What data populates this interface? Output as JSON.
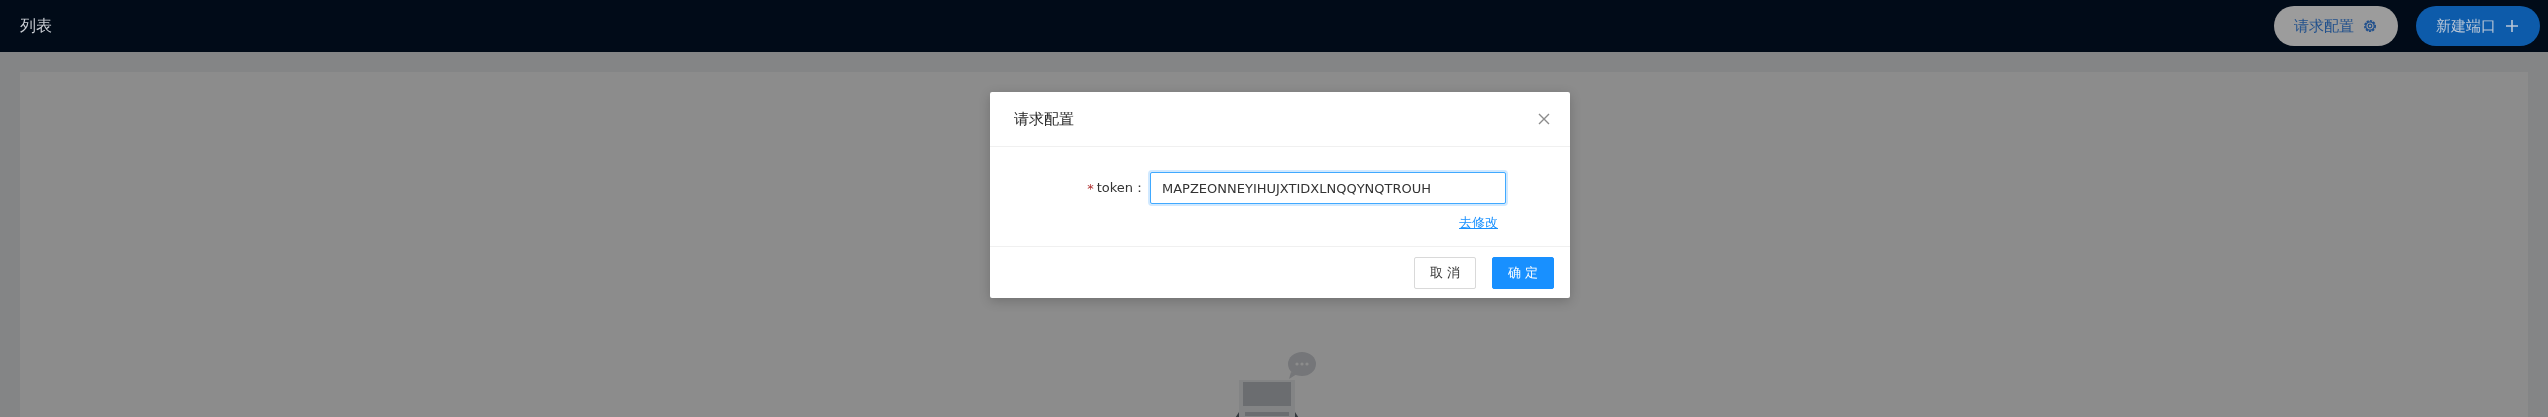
{
  "header": {
    "title": "列表",
    "buttons": [
      {
        "label": "请求配置",
        "kind": "secondary"
      },
      {
        "label": "新建端口",
        "kind": "primary"
      }
    ]
  },
  "dialog": {
    "title": "请求配置",
    "fields": [
      {
        "required_mark": "*",
        "label": "token：",
        "value": "MAPZEONNEYIHUJXTIDXLNQQYNQTROUH",
        "focused": true
      }
    ],
    "link": "去修改",
    "buttons": [
      {
        "label": "取 消",
        "kind": "default"
      },
      {
        "label": "确 定",
        "kind": "primary"
      }
    ]
  }
}
